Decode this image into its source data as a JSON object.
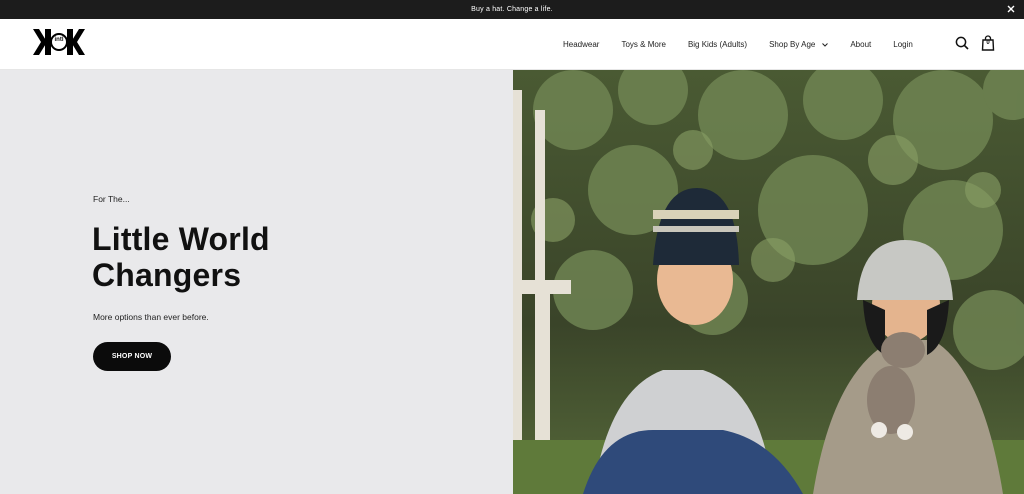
{
  "announcement": {
    "text": "Buy a hat. Change a life.",
    "close_icon": "close-icon"
  },
  "header": {
    "logo_text": "intl",
    "nav": [
      {
        "label": "Headwear"
      },
      {
        "label": "Toys & More"
      },
      {
        "label": "Big Kids (Adults)"
      },
      {
        "label": "Shop By Age",
        "dropdown": true
      },
      {
        "label": "About"
      },
      {
        "label": "Login"
      }
    ],
    "search_icon": "search-icon",
    "cart_icon": "shopping-bag-icon",
    "cart_count": "0"
  },
  "hero": {
    "eyebrow": "For The...",
    "headline_line1": "Little World",
    "headline_line2": "Changers",
    "subtext": "More options than ever before.",
    "cta_label": "SHOP NOW",
    "image": "photo-two-children-in-knit-beanies-in-garden",
    "bg_color": "#e9e9eb",
    "cta_color": "#0b0b0b"
  }
}
